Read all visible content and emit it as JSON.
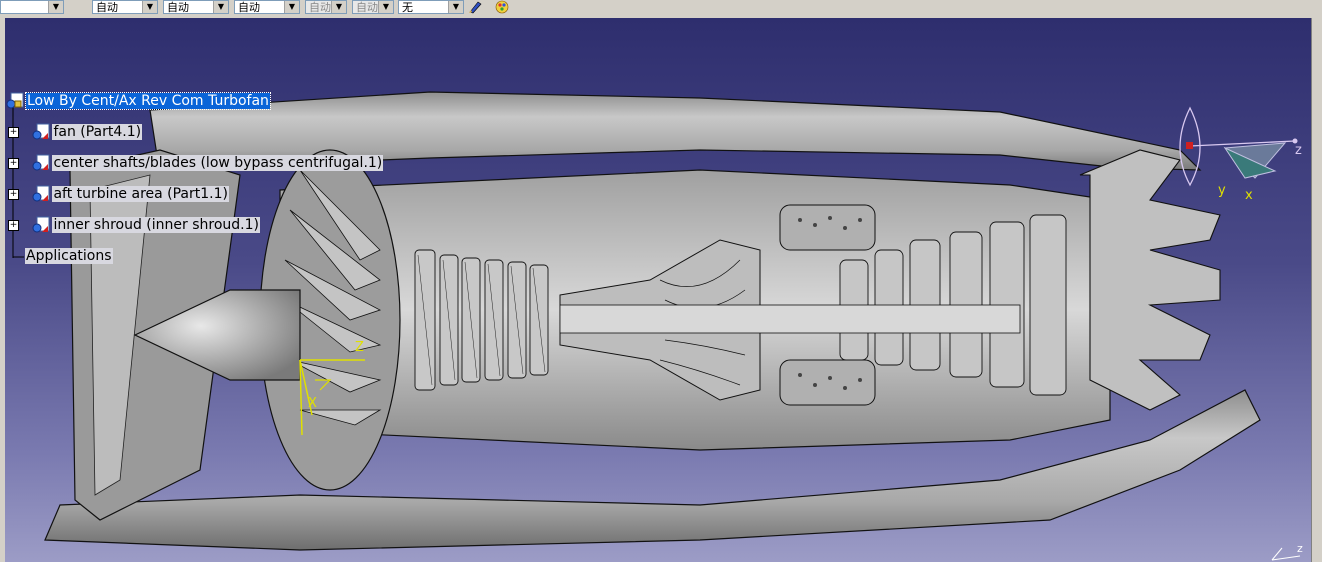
{
  "toolbar": {
    "combos": [
      {
        "value": "",
        "disabled": false
      },
      {
        "value": "自动",
        "disabled": false
      },
      {
        "value": "自动",
        "disabled": false
      },
      {
        "value": "自动",
        "disabled": false
      },
      {
        "value": "自动",
        "disabled": true
      },
      {
        "value": "自动",
        "disabled": true
      },
      {
        "value": "无",
        "disabled": false
      }
    ],
    "icons": [
      "paint-brush-icon",
      "color-palette-icon"
    ]
  },
  "tree": {
    "root": "Low By Cent/Ax Rev Com Turbofan",
    "children": [
      "fan (Part4.1)",
      "center shafts/blades (low bypass centrifugal.1)",
      "aft turbine area (Part1.1)",
      "inner shroud (inner shroud.1)"
    ],
    "applications": "Applications"
  },
  "axes": {
    "compass": {
      "z": "z",
      "y": "y",
      "x": "x"
    },
    "local": {
      "z": "Z",
      "x": "X"
    },
    "corner": {
      "z": "z"
    }
  },
  "colors": {
    "background_top": "#2e2e6e",
    "background_bottom": "#9c9cc6",
    "model": "#b4b4b4",
    "selection": "#0a64d8",
    "axis_yellow": "#e0e000",
    "compass_outline": "#d8c8f0"
  }
}
